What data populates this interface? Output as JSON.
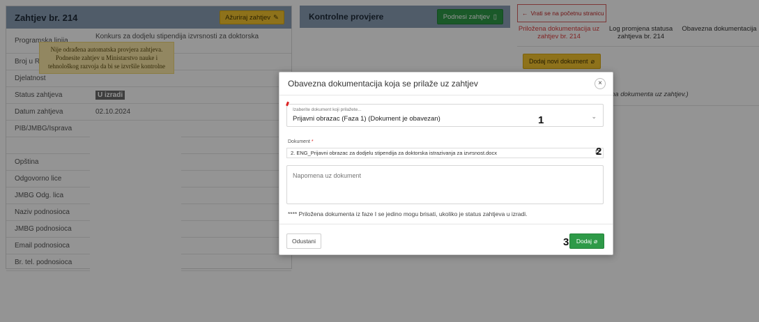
{
  "left_panel": {
    "title": "Zahtjev br. 214",
    "update_button": "Ažuriraj zahtjev",
    "rows": [
      {
        "label": "Programska linija",
        "value": "Konkurs za dodjelu stipendija izvrsnosti za doktorska istraživanja u Crnoj Gori"
      },
      {
        "label": "Broj u Registru",
        "value": "-"
      },
      {
        "label": "Djelatnost",
        "value": ""
      },
      {
        "label": "Status zahtjeva",
        "value": "U izradi"
      },
      {
        "label": "Datum zahtjeva",
        "value": "02.10.2024"
      },
      {
        "label": "PIB/JMBG/Isprava",
        "value": ""
      },
      {
        "label": "",
        "value": ""
      },
      {
        "label": "Opština",
        "value": ""
      },
      {
        "label": "Odgovorno lice",
        "value": ""
      },
      {
        "label": "JMBG Odg. lica",
        "value": ""
      },
      {
        "label": "Naziv podnosioca",
        "value": ""
      },
      {
        "label": "JMBG podnosioca",
        "value": ""
      },
      {
        "label": "Email podnosioca",
        "value": ""
      },
      {
        "label": "Br. tel. podnosioca",
        "value": ""
      }
    ]
  },
  "mid_panel": {
    "title": "Kontrolne provjere",
    "submit_button": "Podnesi zahtjev",
    "notice": "Nije odrađena automatska provjera zahtjeva. Podnesite zahtjev u Ministarstvo nauke i tehnološkog razvoja da bi se izvršile kontrolne"
  },
  "right_panel": {
    "back_link": "Vrati se na početnu stranicu",
    "tabs": [
      "Priložena dokumentacija uz zahtjev br. 214",
      "Log promjena statusa zahtjeva br. 214",
      "Obavezna dokumentacija"
    ],
    "add_doc_button": "Dodaj novi dokument",
    "note": "na dokumenta uz zahtjev.)"
  },
  "modal": {
    "title": "Obavezna dokumentacija koja se prilaže uz zahtjev",
    "select_label": "Izaberite dokument koji prilažete...",
    "select_value": "Prijavni obrazac (Faza 1) (Dokument je obavezan)",
    "doc_label": "Dokument",
    "doc_value": "2. ENG_Prijavni obrazac za dodjelu stipendija za doktorska istrazivanja za izvrsnost.docx",
    "note_placeholder": "Napomena uz dokument",
    "hint": "**** Priložena dokumenta iz faze I se jedino mogu brisati, ukoliko je status zahtjeva u izradi.",
    "cancel_button": "Odustani",
    "add_button": "Dodaj"
  },
  "annotations": [
    "1",
    "2",
    "3"
  ],
  "colors": {
    "header": "#8a9fb5",
    "yellow": "#f4c430",
    "green": "#2e9a48",
    "red": "#c02626"
  }
}
